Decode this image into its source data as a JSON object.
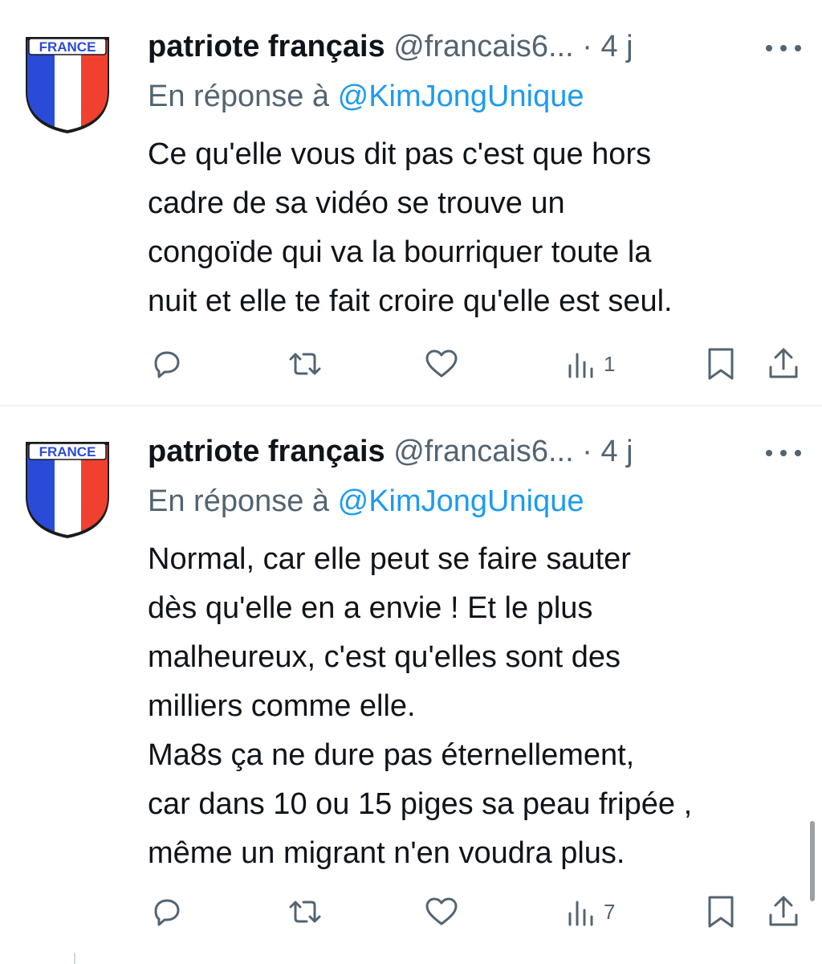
{
  "tweets": [
    {
      "avatar": {
        "badge_text": "FRANCE",
        "colors": [
          "#2a4bd7",
          "#ffffff",
          "#f0402f"
        ]
      },
      "author_name": "patriote français",
      "handle": "@francais6...",
      "dot": "·",
      "time": "4 j",
      "reply_prefix": "En réponse à",
      "reply_to": "@KimJongUnique",
      "text": "Ce qu'elle vous dit pas c'est que hors\ncadre de sa vidéo se trouve un\ncongoïde qui va la bourriquer toute la\nnuit et elle te fait croire qu'elle est seul.",
      "views": "1"
    },
    {
      "avatar": {
        "badge_text": "FRANCE",
        "colors": [
          "#2a4bd7",
          "#ffffff",
          "#f0402f"
        ]
      },
      "author_name": "patriote français",
      "handle": "@francais6...",
      "dot": "·",
      "time": "4 j",
      "reply_prefix": "En réponse à",
      "reply_to": "@KimJongUnique",
      "text": "Normal,  car elle peut se faire sauter\ndès qu'elle en a envie ! Et le plus\nmalheureux, c'est qu'elles sont des\nmilliers comme elle.\nMa8s ça ne dure pas éternellement,\ncar dans 10 ou 15 piges sa peau fripée ,\nmême un migrant n'en voudra plus.",
      "views": "7"
    }
  ],
  "icons": {
    "reply": "reply-icon",
    "retweet": "retweet-icon",
    "like": "heart-icon",
    "views": "views-icon",
    "bookmark": "bookmark-icon",
    "share": "share-icon",
    "more": "more-icon"
  },
  "colors": {
    "accent": "#1d9bf0",
    "muted": "#536471",
    "text": "#0f1419"
  }
}
